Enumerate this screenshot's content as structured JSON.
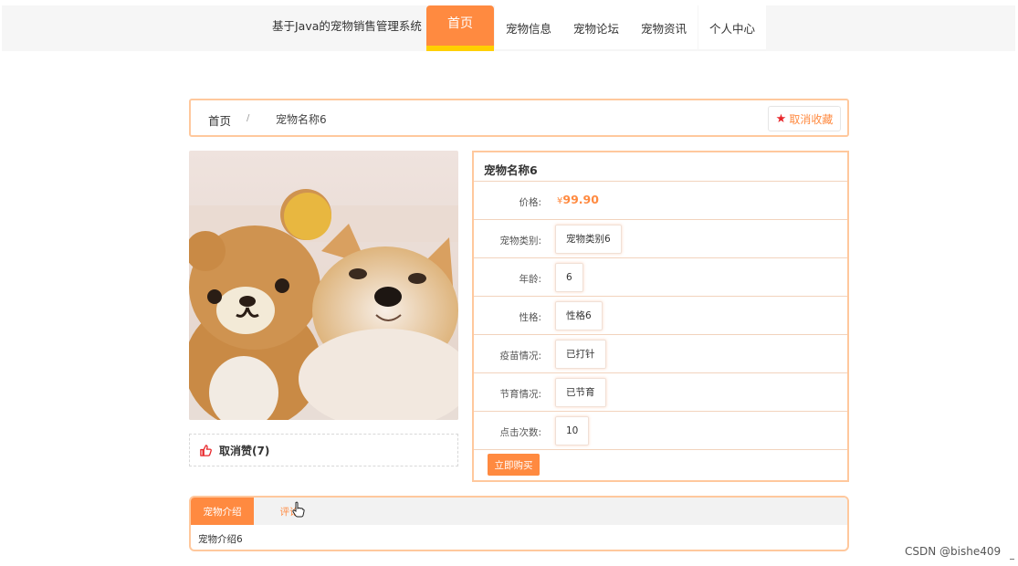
{
  "nav": {
    "brand": "基于Java的宠物销售管理系统",
    "items": [
      "首页",
      "宠物信息",
      "宠物论坛",
      "宠物资讯",
      "个人中心"
    ]
  },
  "breadcrumb": {
    "home": "首页",
    "sep": "/",
    "current": "宠物名称6"
  },
  "favorite": {
    "label": "取消收藏",
    "icon": "star-icon"
  },
  "like": {
    "label": "取消赞(7)",
    "icon": "thumbs-up-icon"
  },
  "detail": {
    "title": "宠物名称6",
    "price_label": "价格:",
    "currency": "¥",
    "price": "99.90",
    "rows": [
      {
        "label": "宠物类别:",
        "value": "宠物类别6"
      },
      {
        "label": "年龄:",
        "value": "6"
      },
      {
        "label": "性格:",
        "value": "性格6"
      },
      {
        "label": "疫苗情况:",
        "value": "已打针"
      },
      {
        "label": "节育情况:",
        "value": "已节育"
      },
      {
        "label": "点击次数:",
        "value": "10"
      }
    ],
    "buy_label": "立即购买"
  },
  "tabs": {
    "items": [
      "宠物介绍",
      "评论"
    ],
    "content": "宠物介绍6"
  },
  "watermark": "CSDN @bishe409",
  "colors": {
    "accent": "#ff8a40",
    "border": "#ffc89d",
    "highlight": "#ffcf00",
    "star": "#e8262a"
  }
}
